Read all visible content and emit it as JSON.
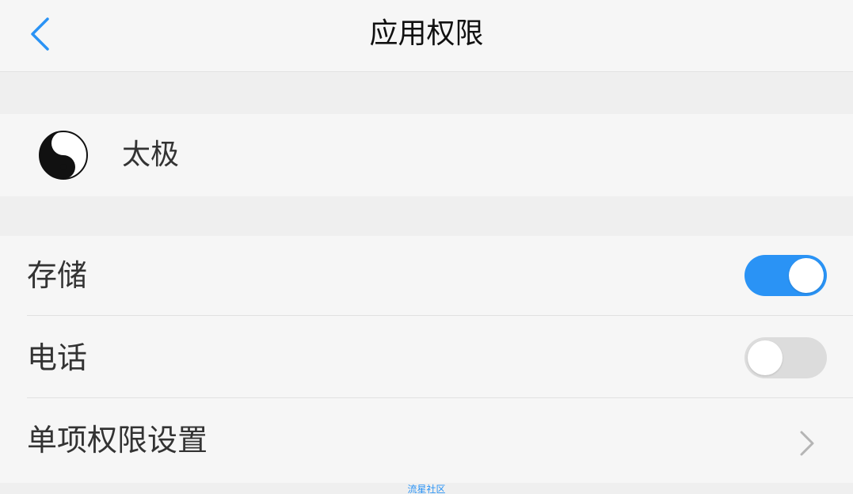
{
  "header": {
    "title": "应用权限",
    "back_icon": "chevron-left-icon"
  },
  "app": {
    "name": "太极",
    "icon": "yin-yang-icon"
  },
  "permissions": [
    {
      "label": "存储",
      "type": "toggle",
      "enabled": true
    },
    {
      "label": "电话",
      "type": "toggle",
      "enabled": false
    },
    {
      "label": "单项权限设置",
      "type": "link",
      "icon": "chevron-right-icon"
    }
  ],
  "watermark": "流星社区",
  "colors": {
    "accent": "#2a93f5",
    "toggle_off": "#dcdcdc",
    "background": "#efefef",
    "card": "#f6f6f6"
  }
}
